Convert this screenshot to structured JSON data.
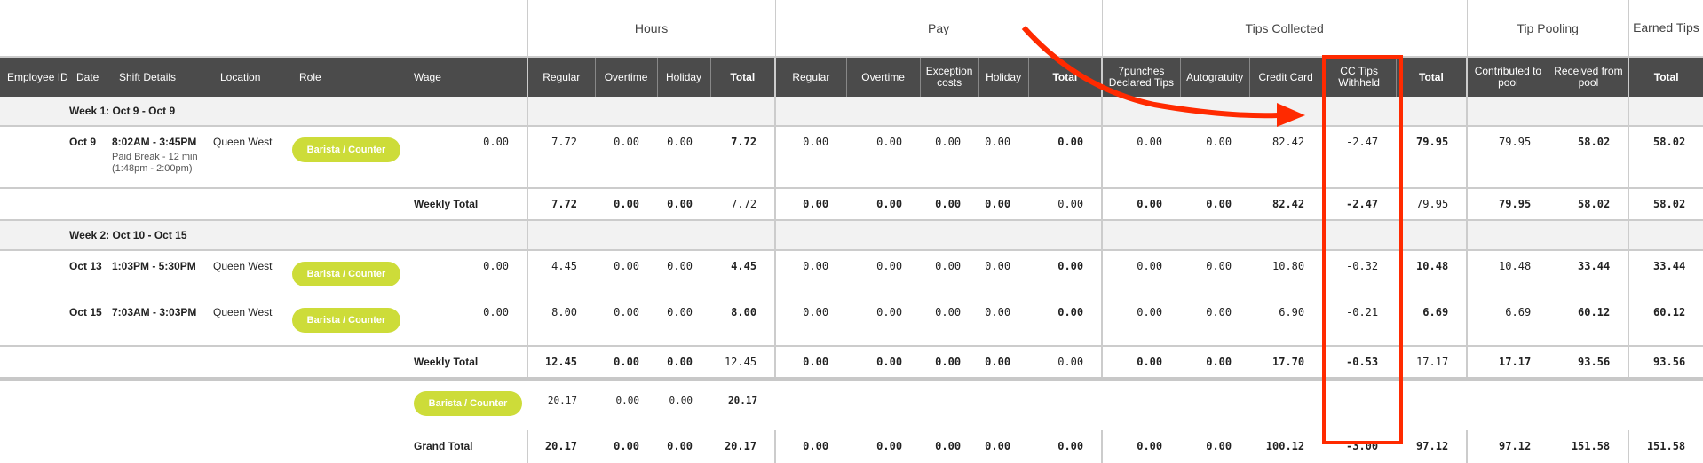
{
  "groups": [
    {
      "label": "Hours",
      "cols": [
        "Regular",
        "Overtime",
        "Holiday",
        "Total"
      ]
    },
    {
      "label": "Pay",
      "cols": [
        "Regular",
        "Overtime",
        "Exception costs",
        "Holiday",
        "Total"
      ]
    },
    {
      "label": "Tips Collected",
      "cols": [
        "7punches Declared Tips",
        "Autogratuity",
        "Credit Card",
        "CC Tips Withheld",
        "Total"
      ]
    },
    {
      "label": "Tip Pooling",
      "cols": [
        "Contributed to pool",
        "Received from pool"
      ]
    },
    {
      "label": "Earned Tips",
      "cols": [
        "Total"
      ]
    }
  ],
  "left_headers": [
    "Employee ID",
    "Date",
    "Shift Details",
    "Location",
    "Role",
    "Wage"
  ],
  "rows": [
    {
      "type": "week",
      "label": "Week 1: Oct 9 - Oct 9"
    },
    {
      "type": "shift",
      "pos": "first",
      "date": "Oct 9",
      "time": "8:02AM - 3:45PM",
      "break": "Paid Break - 12 min",
      "break_range": "(1:48pm - 2:00pm)",
      "location": "Queen West",
      "role": "Barista / Counter",
      "wage": "0.00",
      "values": [
        "7.72",
        "0.00",
        "0.00",
        "7.72",
        "0.00",
        "0.00",
        "0.00",
        "0.00",
        "0.00",
        "0.00",
        "0.00",
        "82.42",
        "-2.47",
        "79.95",
        "79.95",
        "58.02",
        "58.02"
      ]
    },
    {
      "type": "weekly_total",
      "label": "Weekly Total",
      "values": [
        "7.72",
        "0.00",
        "0.00",
        "7.72",
        "0.00",
        "0.00",
        "0.00",
        "0.00",
        "0.00",
        "0.00",
        "0.00",
        "82.42",
        "-2.47",
        "79.95",
        "79.95",
        "58.02",
        "58.02"
      ]
    },
    {
      "type": "week",
      "label": "Week 2: Oct 10 - Oct 15"
    },
    {
      "type": "shift",
      "pos": "mid",
      "date": "Oct 13",
      "time": "1:03PM - 5:30PM",
      "location": "Queen West",
      "role": "Barista / Counter",
      "wage": "0.00",
      "values": [
        "4.45",
        "0.00",
        "0.00",
        "4.45",
        "0.00",
        "0.00",
        "0.00",
        "0.00",
        "0.00",
        "0.00",
        "0.00",
        "10.80",
        "-0.32",
        "10.48",
        "10.48",
        "33.44",
        "33.44"
      ]
    },
    {
      "type": "shift",
      "pos": "last",
      "date": "Oct 15",
      "time": "7:03AM - 3:03PM",
      "location": "Queen West",
      "role": "Barista / Counter",
      "wage": "0.00",
      "values": [
        "8.00",
        "0.00",
        "0.00",
        "8.00",
        "0.00",
        "0.00",
        "0.00",
        "0.00",
        "0.00",
        "0.00",
        "0.00",
        "6.90",
        "-0.21",
        "6.69",
        "6.69",
        "60.12",
        "60.12"
      ]
    },
    {
      "type": "weekly_total",
      "thick": true,
      "label": "Weekly Total",
      "values": [
        "12.45",
        "0.00",
        "0.00",
        "12.45",
        "0.00",
        "0.00",
        "0.00",
        "0.00",
        "0.00",
        "0.00",
        "0.00",
        "17.70",
        "-0.53",
        "17.17",
        "17.17",
        "93.56",
        "93.56"
      ]
    },
    {
      "type": "role_summary",
      "role": "Barista / Counter",
      "values": [
        "20.17",
        "0.00",
        "0.00",
        "20.17"
      ]
    },
    {
      "type": "grand_total",
      "label": "Grand Total",
      "values": [
        "20.17",
        "0.00",
        "0.00",
        "20.17",
        "0.00",
        "0.00",
        "0.00",
        "0.00",
        "0.00",
        "0.00",
        "0.00",
        "100.12",
        "-3.00",
        "97.12",
        "97.12",
        "151.58",
        "151.58"
      ]
    }
  ],
  "colors": {
    "header_bg": "#4b4b4b",
    "role_pill": "#cddc39",
    "annotation": "#ff2a00"
  }
}
